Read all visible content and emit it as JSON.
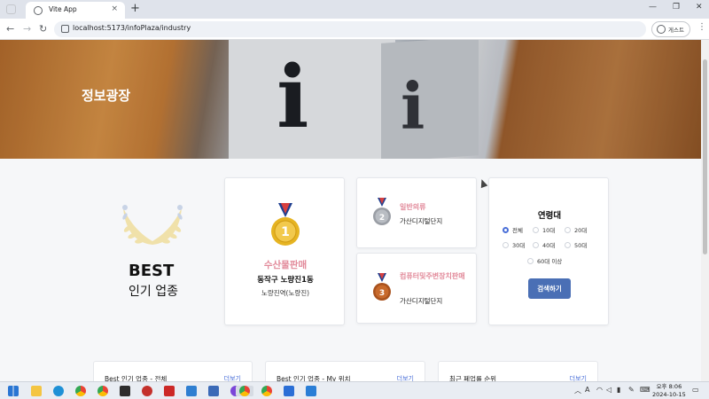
{
  "browser": {
    "tab_title": "Vite App",
    "tab_close": "×",
    "new_tab": "+",
    "url": "localhost:5173/infoPlaza/industry",
    "profile_label": "게스트",
    "window_controls": [
      "—",
      "❐",
      "✕"
    ],
    "nav": {
      "back": "←",
      "forward": "→",
      "reload": "↻"
    },
    "menu": "⋮"
  },
  "hero": {
    "title": "정보광장",
    "letter": "i"
  },
  "best": {
    "title": "BEST",
    "subtitle": "인기 업종"
  },
  "first": {
    "rank": "1",
    "industry": "수산물판매",
    "district": "동작구 노량진1동",
    "station": "노량진역(노량진)"
  },
  "second": {
    "rank": "2",
    "industry": "일반의류",
    "area": "가산디지털단지"
  },
  "third": {
    "rank": "3",
    "industry": "컴퓨터및주변장치판매",
    "area": "가산디지털단지"
  },
  "age_filter": {
    "title": "연령대",
    "options": [
      "전체",
      "10대",
      "20대",
      "30대",
      "40대",
      "50대",
      "60대 이상"
    ],
    "selected": "전체",
    "button": "검색하기"
  },
  "bottom_cards": [
    {
      "title": "Best 인기 업종 - 전체",
      "more": "더보기"
    },
    {
      "title": "Best 인기 업종 - My 위치",
      "more": "더보기"
    },
    {
      "title": "최근 폐업률 순위",
      "more": "더보기"
    }
  ],
  "taskbar": {
    "tray": {
      "ime": "A",
      "period": "오후",
      "time": "8:06",
      "date": "2024-10-15"
    }
  },
  "colors": {
    "accent_pink": "#e28a9a",
    "button_blue": "#4a6fb5",
    "gold": "#e6b422"
  }
}
